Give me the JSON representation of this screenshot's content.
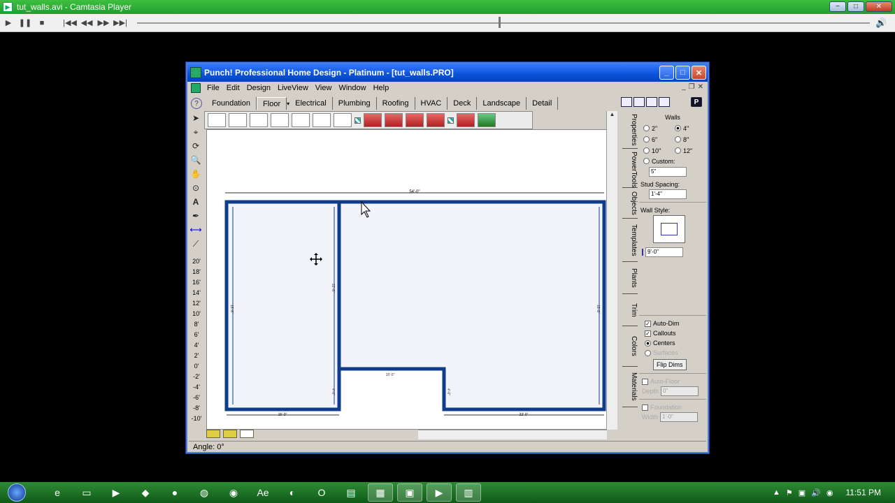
{
  "player": {
    "title": "tut_walls.avi - Camtasia Player",
    "window_buttons": {
      "minimize": "−",
      "maximize": "□",
      "close": "✕"
    },
    "controls": {
      "play": "▶",
      "pause": "❚❚",
      "stop": "■",
      "first": "|◀◀",
      "rewind": "◀◀",
      "forward": "▶▶",
      "last": "▶▶|"
    },
    "seek_position": 0.52
  },
  "app": {
    "title": "Punch! Professional Home Design - Platinum - [tut_walls.PRO]",
    "menu": [
      "File",
      "Edit",
      "Design",
      "LiveView",
      "View",
      "Window",
      "Help"
    ],
    "tabs": [
      "Foundation",
      "Floor",
      "Electrical",
      "Plumbing",
      "Roofing",
      "HVAC",
      "Deck",
      "Landscape",
      "Detail"
    ],
    "active_tab": "Floor",
    "levels": [
      "20'",
      "18'",
      "16'",
      "14'",
      "12'",
      "10'",
      "8'",
      "6'",
      "4'",
      "2'",
      "0'",
      "-2'",
      "-4'",
      "-6'",
      "-8'",
      "-10'"
    ],
    "status": "Angle:  0°",
    "side_tabs": [
      "Properties",
      "PowerTools",
      "Objects",
      "Templates",
      "Plants",
      "Trim",
      "Colors",
      "Materials"
    ]
  },
  "properties": {
    "walls_heading": "Walls",
    "wall_options": [
      "2\"",
      "4\"",
      "6\"",
      "8\"",
      "10\"",
      "12\""
    ],
    "selected_wall": "4\"",
    "custom_label": "Custom:",
    "custom_value": "5\"",
    "stud_spacing_label": "Stud Spacing:",
    "stud_spacing_value": "1'-4\"",
    "wall_style_label": "Wall Style:",
    "wall_height_value": "9'-0\"",
    "auto_dim_label": "Auto-Dim",
    "callouts_label": "Callouts",
    "centers_label": "Centers",
    "surfaces_label": "Surfaces",
    "flip_dims_label": "Flip Dims",
    "auto_floor_label": "Auto-Floor",
    "depth_label": "Depth",
    "depth_value": "0\"",
    "foundation_label": "Foundation",
    "width_label": "Width",
    "width_value": "1'-0\""
  },
  "plan_dims": {
    "top": "54'-0\"",
    "left": "18'-8\"",
    "inner": "22'-8\"",
    "right": "18'-8\"",
    "notch_top": "15'-0\"",
    "notch_left": "4'-0\"",
    "notch_right": "4'-0\"",
    "bottom_left": "15'-0\"",
    "bottom_right": "22'-0\""
  },
  "taskbar": {
    "clock": "11:51 PM"
  }
}
